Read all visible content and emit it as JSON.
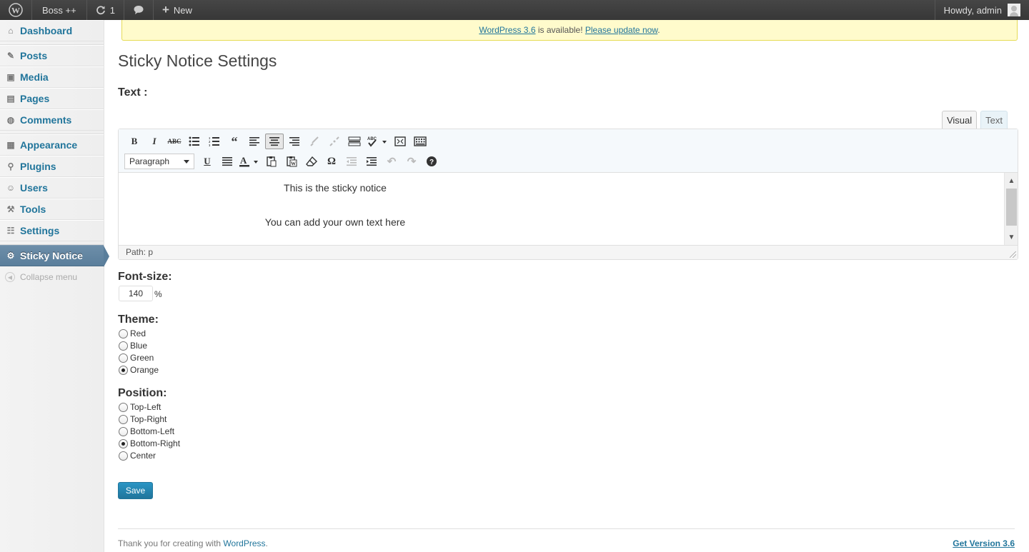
{
  "adminbar": {
    "site_name": "Boss ++",
    "updates_count": "1",
    "new_label": "New",
    "howdy": "Howdy, admin"
  },
  "sidebar": {
    "items": [
      {
        "label": "Dashboard",
        "icon": "dashboard-icon"
      },
      {
        "label": "Posts",
        "icon": "pin-icon"
      },
      {
        "label": "Media",
        "icon": "media-icon"
      },
      {
        "label": "Pages",
        "icon": "pages-icon"
      },
      {
        "label": "Comments",
        "icon": "comment-bubble-icon"
      },
      {
        "label": "Appearance",
        "icon": "appearance-icon"
      },
      {
        "label": "Plugins",
        "icon": "plug-icon"
      },
      {
        "label": "Users",
        "icon": "users-icon"
      },
      {
        "label": "Tools",
        "icon": "tools-icon"
      },
      {
        "label": "Settings",
        "icon": "settings-icon"
      },
      {
        "label": "Sticky Notice",
        "icon": "gear-icon"
      }
    ],
    "collapse_label": "Collapse menu"
  },
  "notice": {
    "version_link": "WordPress 3.6",
    "middle": " is available! ",
    "update_link": "Please update now",
    "end": "."
  },
  "page_title": "Sticky Notice Settings",
  "text_label": "Text :",
  "editor": {
    "tab_visual": "Visual",
    "tab_text": "Text",
    "format_select": "Paragraph",
    "line1": "This is the sticky notice",
    "line2": "You can add your own text here",
    "path": "Path: p"
  },
  "font_size": {
    "label": "Font-size:",
    "value": "140",
    "unit": "%"
  },
  "theme": {
    "label": "Theme:",
    "options": [
      "Red",
      "Blue",
      "Green",
      "Orange"
    ],
    "selected": "Orange"
  },
  "position": {
    "label": "Position:",
    "options": [
      "Top-Left",
      "Top-Right",
      "Bottom-Left",
      "Bottom-Right",
      "Center"
    ],
    "selected": "Bottom-Right"
  },
  "save_label": "Save",
  "footer": {
    "thanks": "Thank you for creating with ",
    "wp_link": "WordPress",
    "period": ".",
    "version_link": "Get Version 3.6"
  },
  "colors": {
    "link": "#21759b",
    "adminbar": "#464646",
    "current_menu": "#5a7e9b",
    "notice_bg": "#fffbcc"
  }
}
